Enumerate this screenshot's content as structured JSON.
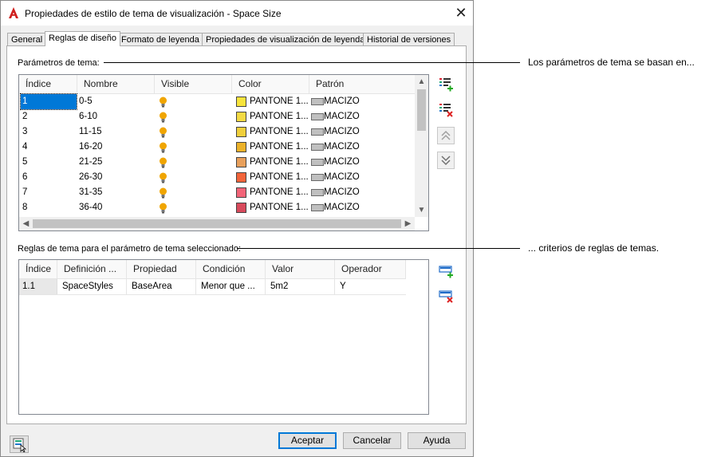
{
  "window": {
    "title": "Propiedades de estilo de tema de visualización - Space Size",
    "close_glyph": "✕"
  },
  "tabs": [
    {
      "label": "General",
      "active": false
    },
    {
      "label": "Reglas de diseño",
      "active": true
    },
    {
      "label": "Formato de leyenda",
      "active": false
    },
    {
      "label": "Propiedades de visualización de leyenda",
      "active": false
    },
    {
      "label": "Historial de versiones",
      "active": false
    }
  ],
  "theme_params": {
    "label": "Parámetros de tema:",
    "columns": [
      "Índice",
      "Nombre",
      "Visible",
      "Color",
      "Patrón"
    ],
    "rows": [
      {
        "index": "1",
        "name": "0-5",
        "color": "PANTONE 1...",
        "color_hex": "#f8e43c",
        "pattern": "MACIZO",
        "selected": true
      },
      {
        "index": "2",
        "name": "6-10",
        "color": "PANTONE 1...",
        "color_hex": "#f4da44",
        "pattern": "MACIZO",
        "selected": false
      },
      {
        "index": "3",
        "name": "11-15",
        "color": "PANTONE 1...",
        "color_hex": "#f0cf3c",
        "pattern": "MACIZO",
        "selected": false
      },
      {
        "index": "4",
        "name": "16-20",
        "color": "PANTONE 1...",
        "color_hex": "#ecb22a",
        "pattern": "MACIZO",
        "selected": false
      },
      {
        "index": "5",
        "name": "21-25",
        "color": "PANTONE 1...",
        "color_hex": "#e8a05c",
        "pattern": "MACIZO",
        "selected": false
      },
      {
        "index": "6",
        "name": "26-30",
        "color": "PANTONE 1...",
        "color_hex": "#f2643a",
        "pattern": "MACIZO",
        "selected": false
      },
      {
        "index": "7",
        "name": "31-35",
        "color": "PANTONE 1...",
        "color_hex": "#f26478",
        "pattern": "MACIZO",
        "selected": false
      },
      {
        "index": "8",
        "name": "36-40",
        "color": "PANTONE 1...",
        "color_hex": "#d84a5c",
        "pattern": "MACIZO",
        "selected": false
      }
    ]
  },
  "rules": {
    "label": "Reglas de tema para el parámetro de tema seleccionado:",
    "columns": [
      "Índice",
      "Definición ...",
      "Propiedad",
      "Condición",
      "Valor",
      "Operador"
    ],
    "rows": [
      {
        "index": "1.1",
        "definition": "SpaceStyles",
        "property": "BaseArea",
        "condition": "Menor que ...",
        "value": "5m2",
        "operator": "Y"
      }
    ]
  },
  "buttons": {
    "ok": "Aceptar",
    "cancel": "Cancelar",
    "help": "Ayuda"
  },
  "callouts": {
    "theme_params": "Los parámetros de tema se basan en...",
    "rules": "... criterios de reglas de temas."
  },
  "colors": {
    "accent": "#0078d7",
    "bulb": "#f0a500"
  }
}
